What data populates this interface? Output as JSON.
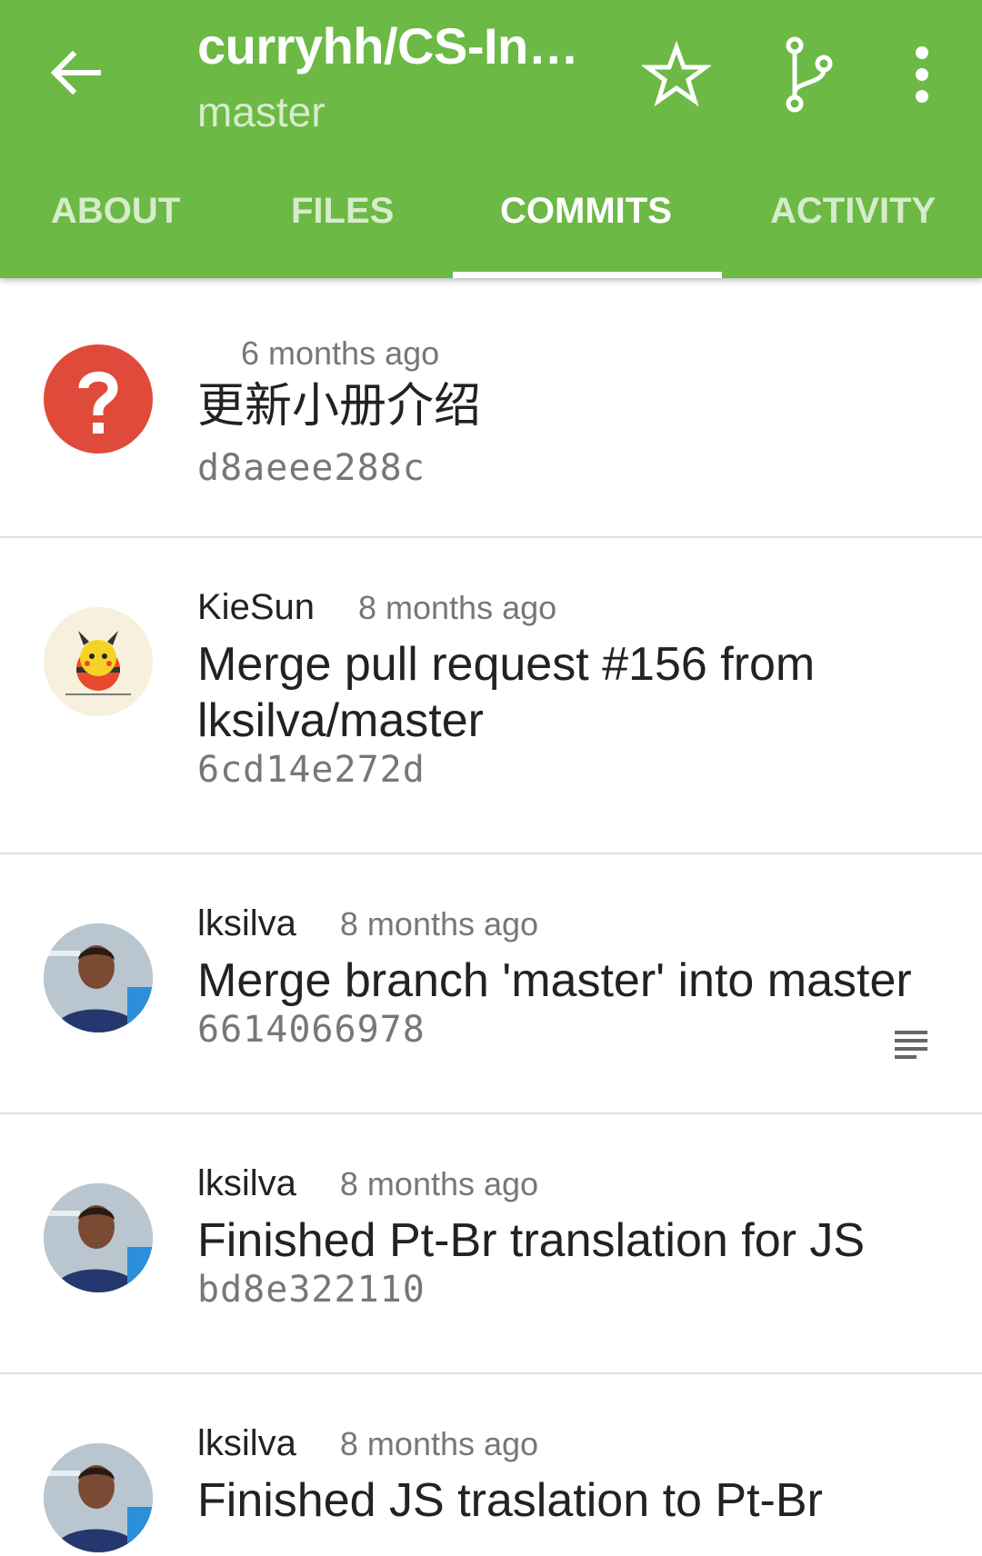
{
  "appbar": {
    "title": "curryhh/CS-In…",
    "branch": "master"
  },
  "tabs": [
    {
      "label": "ABOUT"
    },
    {
      "label": "FILES"
    },
    {
      "label": "COMMITS"
    },
    {
      "label": "ACTIVITY"
    }
  ],
  "commits": [
    {
      "author": "",
      "time": "6 months ago",
      "message": "更新小册介绍",
      "sha": "d8aeee288c",
      "avatar": "unknown-user-icon"
    },
    {
      "author": "KieSun",
      "time": "8 months ago",
      "message": "Merge pull request #156 from lksilva/master",
      "sha": "6cd14e272d",
      "avatar": "pikachu-avatar"
    },
    {
      "author": "lksilva",
      "time": "8 months ago",
      "message": "Merge branch 'master' into master",
      "sha": "6614066978",
      "avatar": "user-photo-avatar"
    },
    {
      "author": "lksilva",
      "time": "8 months ago",
      "message": "Finished Pt-Br translation for JS",
      "sha": "bd8e322110",
      "avatar": "user-photo-avatar"
    },
    {
      "author": "lksilva",
      "time": "8 months ago",
      "message": "Finished JS traslation to Pt-Br",
      "sha": "",
      "avatar": "user-photo-avatar"
    }
  ],
  "colors": {
    "primary": "#6cb945",
    "unknown_avatar": "#e04a3b"
  }
}
